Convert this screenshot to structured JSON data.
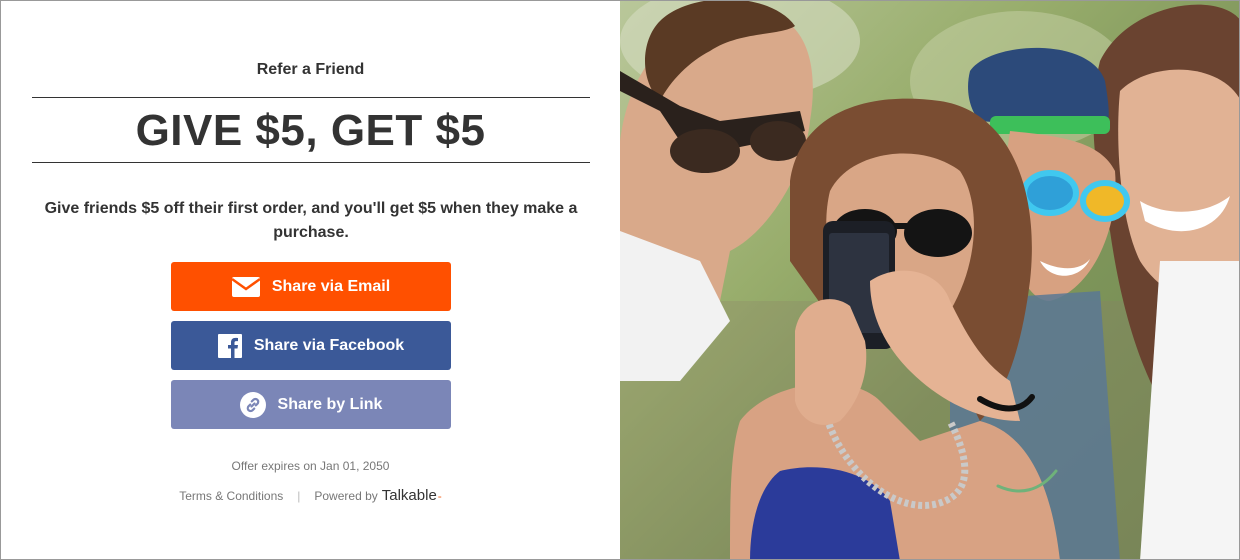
{
  "referral": {
    "eyebrow": "Refer a Friend",
    "headline": "GIVE $5, GET $5",
    "description": "Give friends $5 off their first order, and you'll get $5 when they make a purchase."
  },
  "buttons": {
    "email": {
      "label": "Share via Email",
      "icon": "envelope-icon",
      "color": "#ff5000"
    },
    "facebook": {
      "label": "Share via Facebook",
      "icon": "facebook-icon",
      "color": "#3b5998"
    },
    "link": {
      "label": "Share by Link",
      "icon": "link-icon",
      "color": "#7b86b7"
    }
  },
  "footer": {
    "expires": "Offer expires on Jan 01, 2050",
    "terms": "Terms & Conditions",
    "powered_by": "Powered by",
    "brand": "Talkable"
  },
  "colors": {
    "text": "#333333",
    "muted": "#777777",
    "brand_accent": "#f26522"
  }
}
